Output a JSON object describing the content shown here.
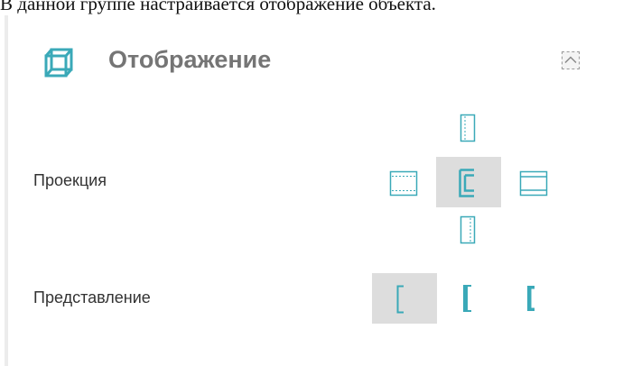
{
  "caption": "В данной группе настраивается отображение объекта.",
  "panel": {
    "title": "Отображение",
    "accent_color": "#3aa9b8",
    "header_icon": "cube-icon",
    "collapse_icon": "chevron-up-icon",
    "collapse_state": "expanded"
  },
  "projection": {
    "label": "Проекция",
    "options": [
      {
        "name": "top",
        "icon": "projection-top-icon",
        "selected": false
      },
      {
        "name": "left",
        "icon": "projection-left-icon",
        "selected": false
      },
      {
        "name": "front",
        "icon": "projection-front-icon",
        "selected": true
      },
      {
        "name": "right",
        "icon": "projection-right-icon",
        "selected": false
      },
      {
        "name": "bottom",
        "icon": "projection-bottom-icon",
        "selected": false
      }
    ]
  },
  "representation": {
    "label": "Представление",
    "options": [
      {
        "name": "outline",
        "icon": "bracket-outline-icon",
        "selected": true
      },
      {
        "name": "partial-fill",
        "icon": "bracket-partial-fill-icon",
        "selected": false
      },
      {
        "name": "fill",
        "icon": "bracket-fill-icon",
        "selected": false
      }
    ]
  }
}
